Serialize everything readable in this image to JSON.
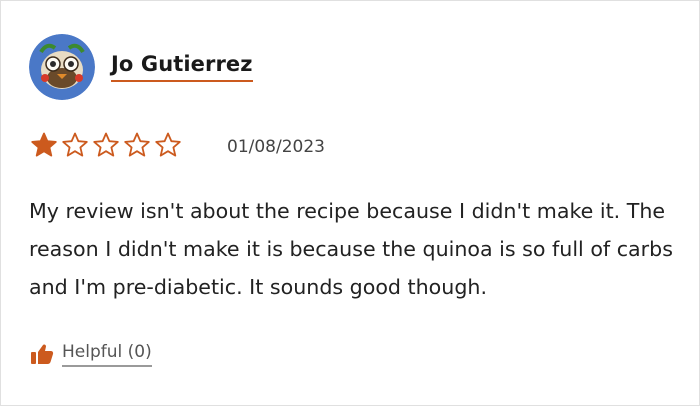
{
  "review": {
    "author": "Jo Gutierrez",
    "rating": {
      "value": 1,
      "max": 5
    },
    "date": "01/08/2023",
    "body": "My review isn't about the recipe because I didn't make it. The reason I didn't make it is because the quinoa is so full of carbs and I'm pre-diabetic. It sounds good though.",
    "helpful_label": "Helpful (0)"
  },
  "icons": {
    "avatar": "avatar-photo",
    "star_filled": "star-filled-icon",
    "star_empty": "star-outline-icon",
    "helpful": "thumbs-up-icon"
  },
  "colors": {
    "accent": "#cc5a1e",
    "avatar_bg": "#4a78c7",
    "text": "#222222"
  }
}
